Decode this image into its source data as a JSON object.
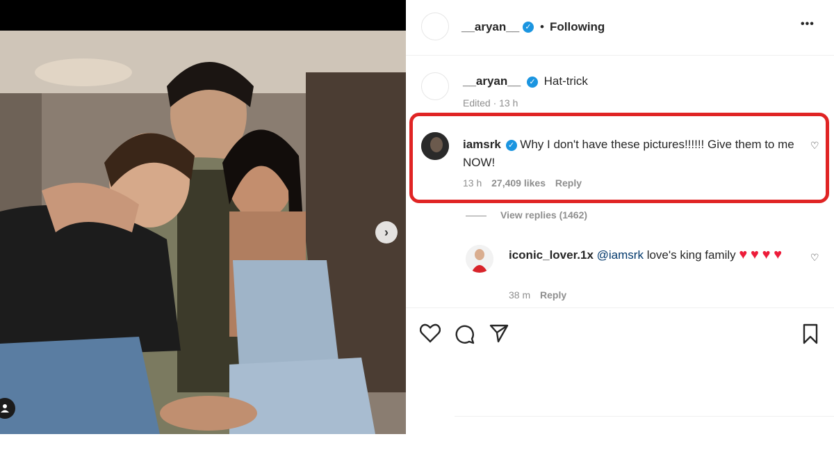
{
  "post": {
    "author": "__aryan__",
    "follow_status": "Following",
    "more_label": "•••"
  },
  "caption": {
    "author": "__aryan__",
    "text": "Hat-trick",
    "meta": "Edited · 13 h"
  },
  "comments": [
    {
      "author": "iamsrk",
      "text": "Why I don't have these pictures!!!!!! Give them to me NOW!",
      "time": "13 h",
      "likes": "27,409 likes",
      "reply_label": "Reply",
      "view_replies": "View replies (1462)"
    }
  ],
  "reply": {
    "author": "iconic_lover.1x",
    "mention": "@iamsrk",
    "text": "love's king family",
    "time": "38 m",
    "reply_label": "Reply"
  },
  "colors": {
    "verified": "#1b95e0",
    "highlight": "#e02424",
    "heart": "#ed1c3a"
  },
  "icons": [
    "heart-icon",
    "comment-icon",
    "share-icon",
    "bookmark-icon",
    "chevron-right-icon",
    "user-tag-icon",
    "verified-icon"
  ]
}
